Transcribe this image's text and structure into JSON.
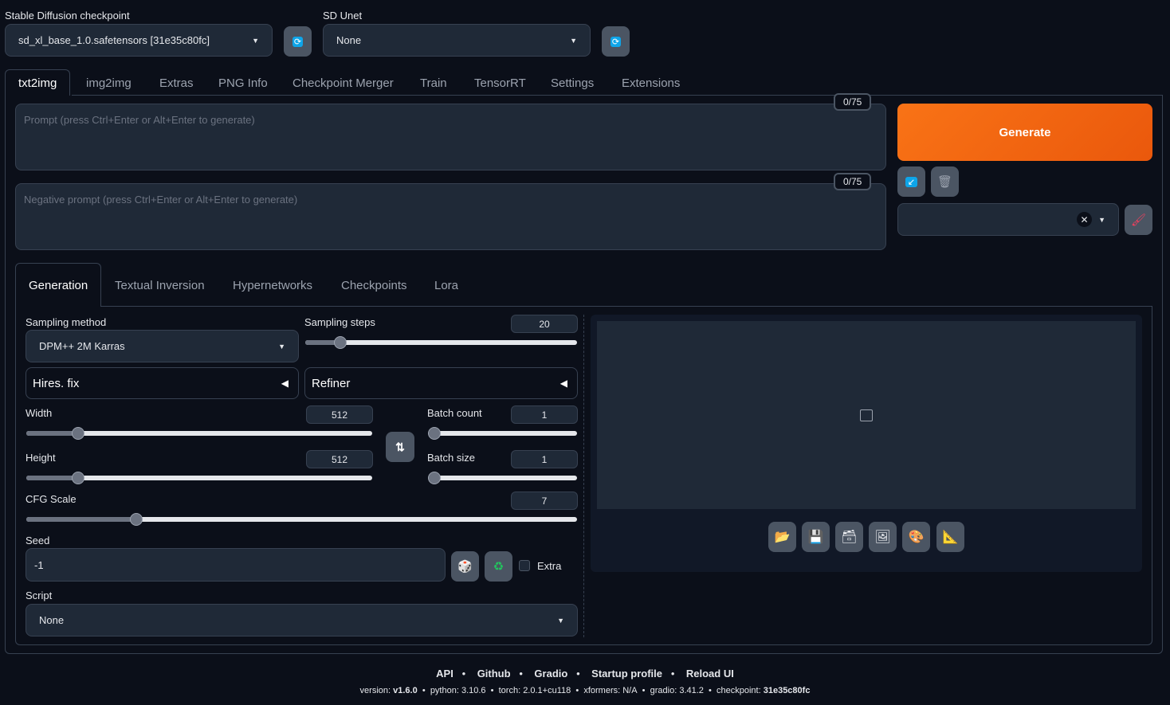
{
  "top": {
    "checkpoint_label": "Stable Diffusion checkpoint",
    "checkpoint_value": "sd_xl_base_1.0.safetensors [31e35c80fc]",
    "unet_label": "SD Unet",
    "unet_value": "None"
  },
  "tabs": [
    "txt2img",
    "img2img",
    "Extras",
    "PNG Info",
    "Checkpoint Merger",
    "Train",
    "TensorRT",
    "Settings",
    "Extensions"
  ],
  "prompt": {
    "placeholder": "Prompt (press Ctrl+Enter or Alt+Enter to generate)",
    "counter": "0/75"
  },
  "negative": {
    "placeholder": "Negative prompt (press Ctrl+Enter or Alt+Enter to generate)",
    "counter": "0/75"
  },
  "generate_label": "Generate",
  "subtabs": [
    "Generation",
    "Textual Inversion",
    "Hypernetworks",
    "Checkpoints",
    "Lora"
  ],
  "params": {
    "sampling_method_label": "Sampling method",
    "sampling_method": "DPM++ 2M Karras",
    "steps_label": "Sampling steps",
    "steps": "20",
    "hires_label": "Hires. fix",
    "refiner_label": "Refiner",
    "width_label": "Width",
    "width": "512",
    "height_label": "Height",
    "height": "512",
    "batch_count_label": "Batch count",
    "batch_count": "1",
    "batch_size_label": "Batch size",
    "batch_size": "1",
    "cfg_label": "CFG Scale",
    "cfg": "7",
    "seed_label": "Seed",
    "seed": "-1",
    "extra_label": "Extra",
    "script_label": "Script",
    "script": "None"
  },
  "slider_fractions": {
    "steps": 0.13,
    "width": 0.15,
    "height": 0.15,
    "batch_count": 0,
    "batch_size": 0,
    "cfg": 0.2
  },
  "footer": {
    "links": [
      "API",
      "Github",
      "Gradio",
      "Startup profile",
      "Reload UI"
    ],
    "version_label": "version:",
    "version": "v1.6.0",
    "python": "python: 3.10.6",
    "torch": "torch: 2.0.1+cu118",
    "xformers": "xformers: N/A",
    "gradio": "gradio: 3.41.2",
    "checkpoint_label": "checkpoint:",
    "checkpoint": "31e35c80fc"
  },
  "colors": {
    "accent": "#f26b11",
    "background": "#0b0f19",
    "panel": "#1f2937"
  }
}
